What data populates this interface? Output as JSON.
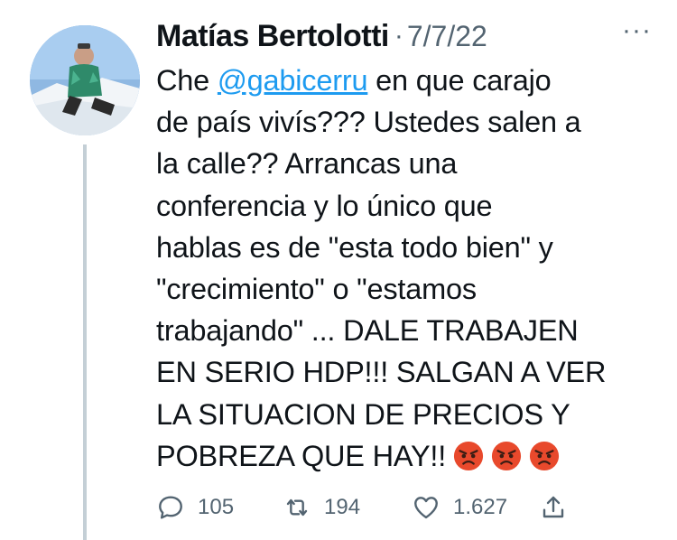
{
  "tweet": {
    "author_name": "Matías Bertolotti",
    "separator": "·",
    "date": "7/7/22",
    "more_label": "···",
    "text_lines": [
      {
        "before": "Che ",
        "mention": "@gabicerru",
        "after": " en que carajo"
      },
      "de país vivís??? Ustedes salen a",
      "la calle?? Arrancas una",
      "conferencia y lo único que",
      "hablas es de \"esta todo bien\" y",
      "\"crecimiento\" o \"estamos",
      "trabajando\" ... DALE TRABAJEN",
      "EN SERIO HDP!!! SALGAN A VER",
      "LA SITUACION DE PRECIOS Y",
      "POBREZA QUE HAY!!"
    ],
    "emojis": [
      "angry-face-emoji",
      "angry-face-emoji",
      "angry-face-emoji"
    ]
  },
  "actions": {
    "reply_count": "105",
    "retweet_count": "194",
    "like_count": "1.627",
    "icons": [
      "reply-icon",
      "retweet-icon",
      "like-icon",
      "share-icon"
    ]
  },
  "colors": {
    "text": "#0f1419",
    "secondary": "#536471",
    "link": "#1d9bf0",
    "thread_line": "#c4cfd6",
    "emoji_red": "#e8492c"
  }
}
